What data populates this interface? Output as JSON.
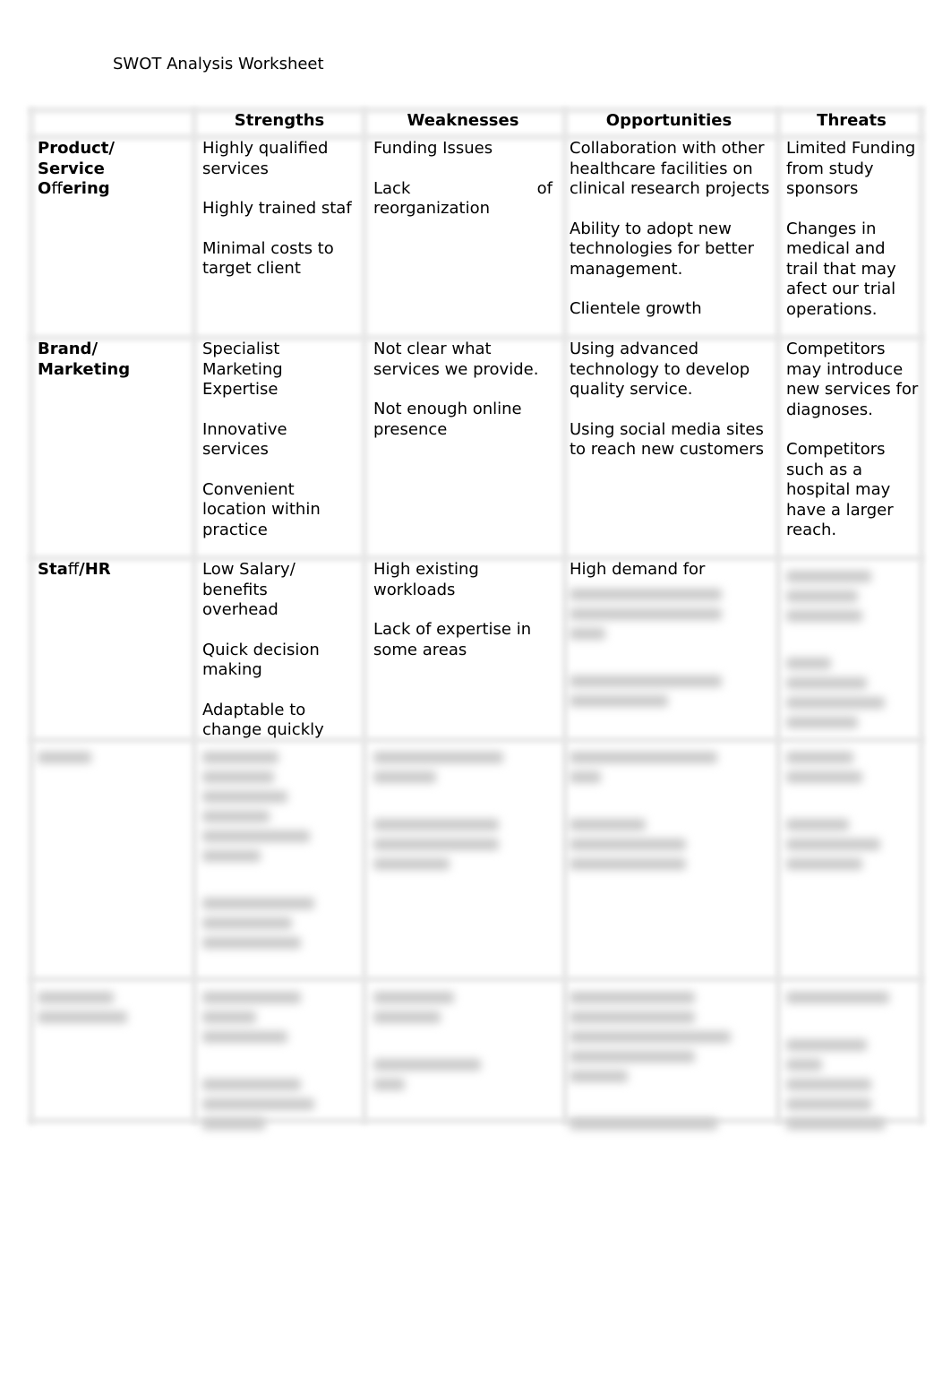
{
  "document": {
    "title": "SWOT Analysis Worksheet"
  },
  "table": {
    "columns": [
      "",
      "Strengths",
      "Weaknesses",
      "Opportunities",
      "Threats"
    ],
    "rows": [
      {
        "label_parts": [
          "Product/",
          "Service",
          "O",
          "ff",
          "ering"
        ],
        "strengths": [
          "Highly qualified services",
          "Highly trained staf",
          "Minimal costs to target client"
        ],
        "weaknesses": [
          "Funding Issues",
          "Lack",
          "of",
          "reorganization"
        ],
        "opportunities": [
          "Collaboration with other healthcare facilities on clinical research projects",
          "Ability to adopt new technologies for better management.",
          "Clientele growth"
        ],
        "threats": [
          "Limited Funding from study sponsors",
          "Changes in medical and trail that may afect our trial operations."
        ]
      },
      {
        "label_parts": [
          "Brand/",
          "Marketing"
        ],
        "strengths": [
          "Specialist Marketing Expertise",
          "Innovative services",
          "Convenient location within practice"
        ],
        "weaknesses": [
          "Not clear what services we provide.",
          "Not enough online presence"
        ],
        "opportunities": [
          "Using advanced technology to develop quality service.",
          "Using social media sites to reach new customers"
        ],
        "threats": [
          "Competitors may introduce new services for diagnoses.",
          "Competitors such as a hospital may have a larger reach."
        ]
      },
      {
        "label_parts": [
          "Sta",
          "ff",
          "/HR"
        ],
        "strengths": [
          "Low Salary/ benefits overhead",
          "Quick decision making",
          "Adaptable to change quickly"
        ],
        "weaknesses": [
          "High existing workloads",
          "Lack of expertise in some areas"
        ],
        "opportunities": [
          "High demand for"
        ],
        "threats": []
      }
    ],
    "obscured_note": "Remaining content is blurred / not legible"
  }
}
